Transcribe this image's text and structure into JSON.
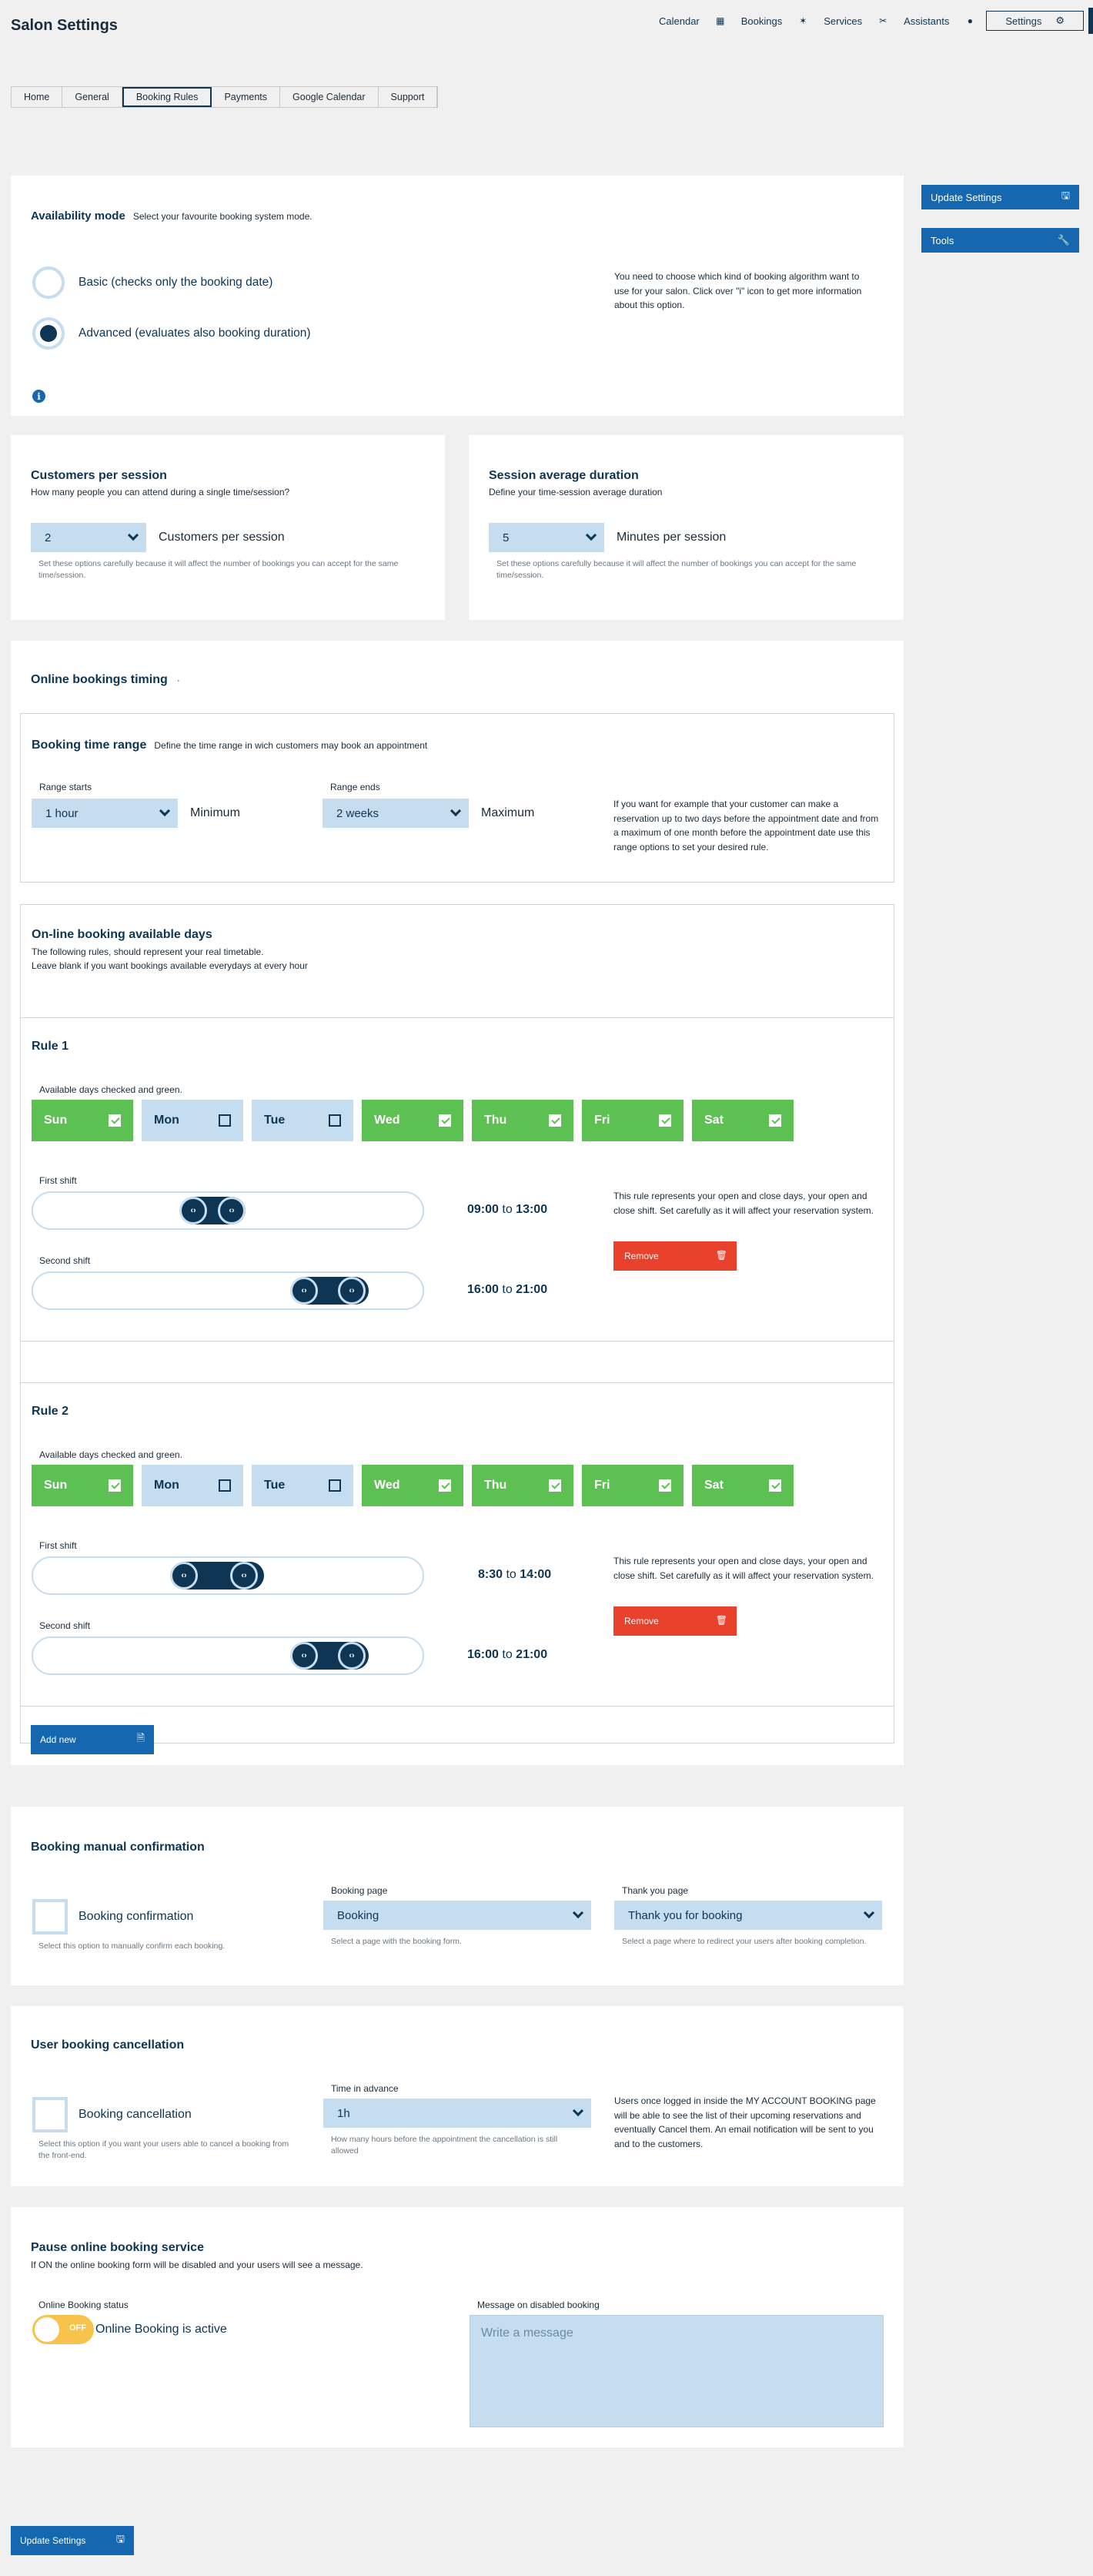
{
  "header": {
    "title": "Salon Settings",
    "nav": [
      "Calendar",
      "Bookings",
      "Services",
      "Assistants",
      "Settings"
    ]
  },
  "tabs": [
    "Home",
    "General",
    "Booking Rules",
    "Payments",
    "Google Calendar",
    "Support"
  ],
  "active_tab": "Booking Rules",
  "side": {
    "update": "Update Settings",
    "tools": "Tools"
  },
  "availability": {
    "title": "Availability mode",
    "subtitle": "Select your favourite booking system mode.",
    "basic": "Basic (checks only the booking date)",
    "advanced": "Advanced (evaluates also booking duration)",
    "selected": "advanced",
    "note": "You need to choose which kind of booking algorithm want to use for your salon. Click over \"i\" icon to get more information about this option."
  },
  "customers": {
    "title": "Customers per session",
    "subtitle": "How many people you can attend during a single time/session?",
    "value": "2",
    "label": "Customers per session",
    "note": "Set these options carefully because it will affect the number of bookings you can accept for the same time/session."
  },
  "duration": {
    "title": "Session average duration",
    "subtitle": "Define your time-session average duration",
    "value": "5",
    "label": "Minutes per session",
    "note": "Set these options carefully because it will affect the number of bookings you can accept for the same time/session."
  },
  "timing": {
    "title": "Online bookings timing",
    "marker": "·",
    "range_title": "Booking time range",
    "range_sub": "Define the time range in wich customers may book an appointment",
    "starts_label": "Range starts",
    "starts_value": "1 hour",
    "starts_suffix": "Minimum",
    "ends_label": "Range ends",
    "ends_value": "2 weeks",
    "ends_suffix": "Maximum",
    "note": "If you want for example that your customer can make a reservation up to two days before the appointment date and from a maximum of one month before the appointment date use this range options to set your desired rule."
  },
  "days_section": {
    "title": "On-line booking available days",
    "line1": "The following rules, should represent your real timetable.",
    "line2": "Leave blank if you want bookings available everydays at every hour"
  },
  "rules": [
    {
      "title": "Rule 1",
      "days_label": "Available days checked and green.",
      "days": [
        {
          "name": "Sun",
          "on": true
        },
        {
          "name": "Mon",
          "on": false
        },
        {
          "name": "Tue",
          "on": false
        },
        {
          "name": "Wed",
          "on": true
        },
        {
          "name": "Thu",
          "on": true
        },
        {
          "name": "Fri",
          "on": true
        },
        {
          "name": "Sat",
          "on": true
        }
      ],
      "first_label": "First shift",
      "first_from": "09:00",
      "first_to": "13:00",
      "second_label": "Second shift",
      "second_from": "16:00",
      "second_to": "21:00",
      "to": "to",
      "note": "This rule represents your open and close days, your open and close shift. Set carefully as it will affect your reservation system.",
      "remove": "Remove"
    },
    {
      "title": "Rule 2",
      "days_label": "Available days checked and green.",
      "days": [
        {
          "name": "Sun",
          "on": true
        },
        {
          "name": "Mon",
          "on": false
        },
        {
          "name": "Tue",
          "on": false
        },
        {
          "name": "Wed",
          "on": true
        },
        {
          "name": "Thu",
          "on": true
        },
        {
          "name": "Fri",
          "on": true
        },
        {
          "name": "Sat",
          "on": true
        }
      ],
      "first_label": "First shift",
      "first_from": "8:30",
      "first_to": "14:00",
      "second_label": "Second shift",
      "second_from": "16:00",
      "second_to": "21:00",
      "to": "to",
      "note": "This rule represents your open and close days, your open and close shift. Set carefully as it will affect your reservation system.",
      "remove": "Remove"
    }
  ],
  "add_new": "Add new",
  "confirmation": {
    "title": "Booking manual confirmation",
    "checkbox": "Booking confirmation",
    "checkbox_note": "Select this option to manually confirm each booking.",
    "page_label": "Booking page",
    "page_value": "Booking",
    "page_note": "Select a page with the booking form.",
    "thanks_label": "Thank you page",
    "thanks_value": "Thank you for booking",
    "thanks_note": "Select a page where to redirect your users after booking completion."
  },
  "cancellation": {
    "title": "User booking cancellation",
    "checkbox": "Booking cancellation",
    "checkbox_note": "Select this option if you want your users able to cancel a booking from the front-end.",
    "time_label": "Time in advance",
    "time_value": "1h",
    "time_note": "How many hours before the appointment the cancellation is still allowed",
    "note": "Users once logged in inside the MY ACCOUNT BOOKING page will be able to see the list of their upcoming reservations and eventually Cancel them. An email notification will be sent to you and to the customers."
  },
  "pause": {
    "title": "Pause online booking service",
    "subtitle": "If ON the online booking form will be disabled and your users will see a message.",
    "status_label": "Online Booking status",
    "toggle_text": "OFF",
    "status_text": "Online Booking is active",
    "message_label": "Message on disabled booking",
    "message_placeholder": "Write a message"
  },
  "bottom_update": "Update Settings",
  "colors": {
    "navy": "#0e3554",
    "accent_blue": "#1568b0",
    "light_blue": "#c6ddef",
    "green": "#5cc052",
    "red": "#e8412c",
    "toggle": "#f8c34c"
  }
}
